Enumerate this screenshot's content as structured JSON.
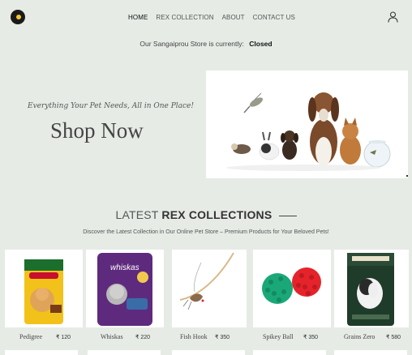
{
  "nav": {
    "items": [
      {
        "label": "HOME",
        "active": true
      },
      {
        "label": "REX COLLECTION",
        "active": false
      },
      {
        "label": "ABOUT",
        "active": false
      },
      {
        "label": "CONTACT US",
        "active": false
      }
    ]
  },
  "store_status": {
    "prefix": "Our Sangaiprou Store is currently:",
    "status": "Closed"
  },
  "hero": {
    "tagline": "Everything Your Pet Needs, All in One Place!",
    "title": "Shop Now"
  },
  "section": {
    "title_light": "LATEST",
    "title_bold": "REX COLLECTIONS",
    "subtitle": "Discover the Latest Collection in Our Online Pet Store – Premium Products for Your Beloved Pets!"
  },
  "products": [
    {
      "name": "Pedigree",
      "price": "₹ 120"
    },
    {
      "name": "Whiskas",
      "price": "₹ 220"
    },
    {
      "name": "Fish Hook",
      "price": "₹ 350"
    },
    {
      "name": "Spikey Ball",
      "price": "₹ 350"
    },
    {
      "name": "Grains Zero",
      "price": "₹ 580"
    }
  ],
  "colors": {
    "background": "#e6ebe6",
    "text": "#333333"
  }
}
